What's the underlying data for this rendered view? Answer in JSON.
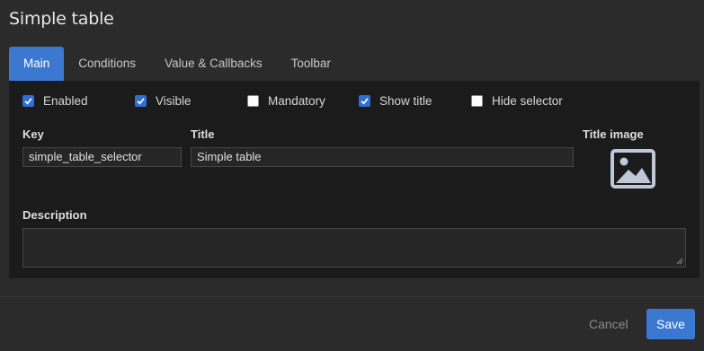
{
  "dialog": {
    "title": "Simple table"
  },
  "tabs": [
    {
      "label": "Main",
      "active": true
    },
    {
      "label": "Conditions",
      "active": false
    },
    {
      "label": "Value & Callbacks",
      "active": false
    },
    {
      "label": "Toolbar",
      "active": false
    }
  ],
  "checkboxes": [
    {
      "label": "Enabled",
      "checked": true
    },
    {
      "label": "Visible",
      "checked": true
    },
    {
      "label": "Mandatory",
      "checked": false
    },
    {
      "label": "Show title",
      "checked": true
    },
    {
      "label": "Hide selector",
      "checked": false
    }
  ],
  "fields": {
    "key": {
      "label": "Key",
      "value": "simple_table_selector"
    },
    "title": {
      "label": "Title",
      "value": "Simple table"
    },
    "title_image": {
      "label": "Title image",
      "icon": "image-placeholder-icon"
    },
    "description": {
      "label": "Description",
      "value": ""
    }
  },
  "footer": {
    "cancel_label": "Cancel",
    "save_label": "Save"
  },
  "colors": {
    "accent": "#3b78d0",
    "panel": "#1b1b1b",
    "background": "#2b2b2b"
  }
}
